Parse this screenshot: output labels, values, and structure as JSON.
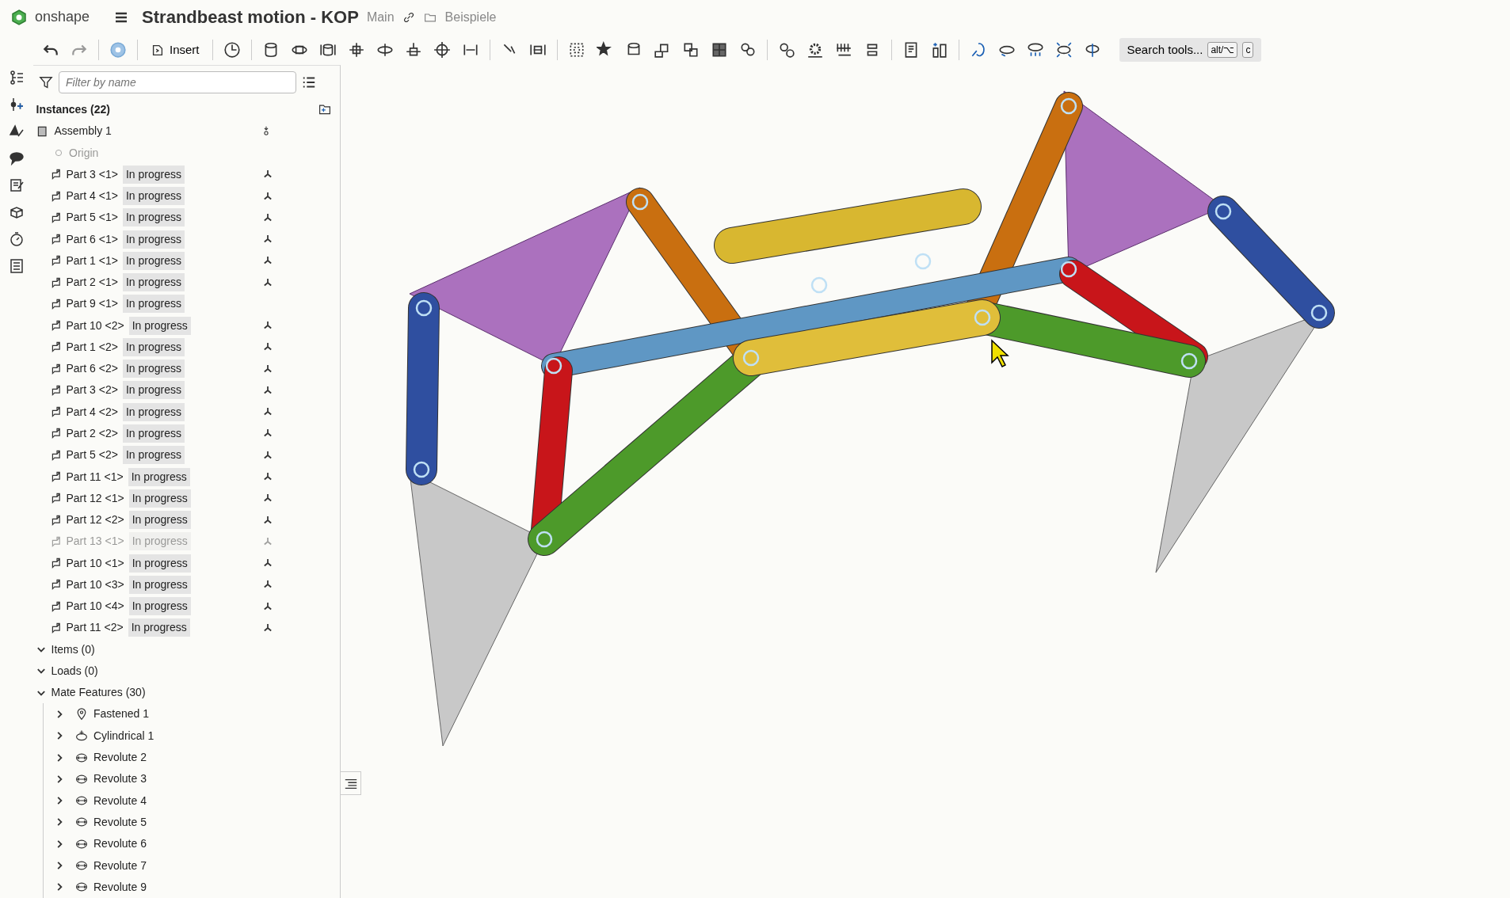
{
  "header": {
    "logo_text": "onshape",
    "title": "Strandbeast motion - KOP",
    "branch": "Main",
    "folder": "Beispiele"
  },
  "toolbar": {
    "insert_label": "Insert",
    "search": {
      "label": "Search tools...",
      "keys": [
        "alt/⌥",
        "c"
      ]
    }
  },
  "filter": {
    "placeholder": "Filter by name"
  },
  "instances": {
    "title": "Instances (22)",
    "assembly": "Assembly 1",
    "origin": {
      "label": "Origin",
      "disabled": true
    },
    "parts": [
      {
        "name": "Part 3 <1>",
        "status": "In progress",
        "disabled": false,
        "connector": true
      },
      {
        "name": "Part 4 <1>",
        "status": "In progress",
        "disabled": false,
        "connector": true
      },
      {
        "name": "Part 5 <1>",
        "status": "In progress",
        "disabled": false,
        "connector": true
      },
      {
        "name": "Part 6 <1>",
        "status": "In progress",
        "disabled": false,
        "connector": true
      },
      {
        "name": "Part 1 <1>",
        "status": "In progress",
        "disabled": false,
        "connector": true
      },
      {
        "name": "Part 2 <1>",
        "status": "In progress",
        "disabled": false,
        "connector": true
      },
      {
        "name": "Part 9 <1>",
        "status": "In progress",
        "disabled": false,
        "connector": false
      },
      {
        "name": "Part 10 <2>",
        "status": "In progress",
        "disabled": false,
        "connector": true
      },
      {
        "name": "Part 1 <2>",
        "status": "In progress",
        "disabled": false,
        "connector": true
      },
      {
        "name": "Part 6 <2>",
        "status": "In progress",
        "disabled": false,
        "connector": true
      },
      {
        "name": "Part 3 <2>",
        "status": "In progress",
        "disabled": false,
        "connector": true
      },
      {
        "name": "Part 4 <2>",
        "status": "In progress",
        "disabled": false,
        "connector": true
      },
      {
        "name": "Part 2 <2>",
        "status": "In progress",
        "disabled": false,
        "connector": true
      },
      {
        "name": "Part 5 <2>",
        "status": "In progress",
        "disabled": false,
        "connector": true
      },
      {
        "name": "Part 11 <1>",
        "status": "In progress",
        "disabled": false,
        "connector": true
      },
      {
        "name": "Part 12 <1>",
        "status": "In progress",
        "disabled": false,
        "connector": true
      },
      {
        "name": "Part 12 <2>",
        "status": "In progress",
        "disabled": false,
        "connector": true
      },
      {
        "name": "Part 13 <1>",
        "status": "In progress",
        "disabled": true,
        "connector": true
      },
      {
        "name": "Part 10 <1>",
        "status": "In progress",
        "disabled": false,
        "connector": true
      },
      {
        "name": "Part 10 <3>",
        "status": "In progress",
        "disabled": false,
        "connector": true
      },
      {
        "name": "Part 10 <4>",
        "status": "In progress",
        "disabled": false,
        "connector": true
      },
      {
        "name": "Part 11 <2>",
        "status": "In progress",
        "disabled": false,
        "connector": true
      }
    ]
  },
  "sections": [
    {
      "label": "Items (0)",
      "expanded": true
    },
    {
      "label": "Loads (0)",
      "expanded": true
    },
    {
      "label": "Mate Features (30)",
      "expanded": true
    }
  ],
  "mates": [
    {
      "kind": "fastened",
      "name": "Fastened 1",
      "expanded": false
    },
    {
      "kind": "cylindrical",
      "name": "Cylindrical 1",
      "expanded": false
    },
    {
      "kind": "revolute",
      "name": "Revolute 2",
      "expanded": false
    },
    {
      "kind": "revolute",
      "name": "Revolute 3",
      "expanded": false
    },
    {
      "kind": "revolute",
      "name": "Revolute 4",
      "expanded": false
    },
    {
      "kind": "revolute",
      "name": "Revolute 5",
      "expanded": false
    },
    {
      "kind": "revolute",
      "name": "Revolute 6",
      "expanded": false
    },
    {
      "kind": "revolute",
      "name": "Revolute 7",
      "expanded": false
    },
    {
      "kind": "revolute",
      "name": "Revolute 9",
      "expanded": false
    }
  ]
}
